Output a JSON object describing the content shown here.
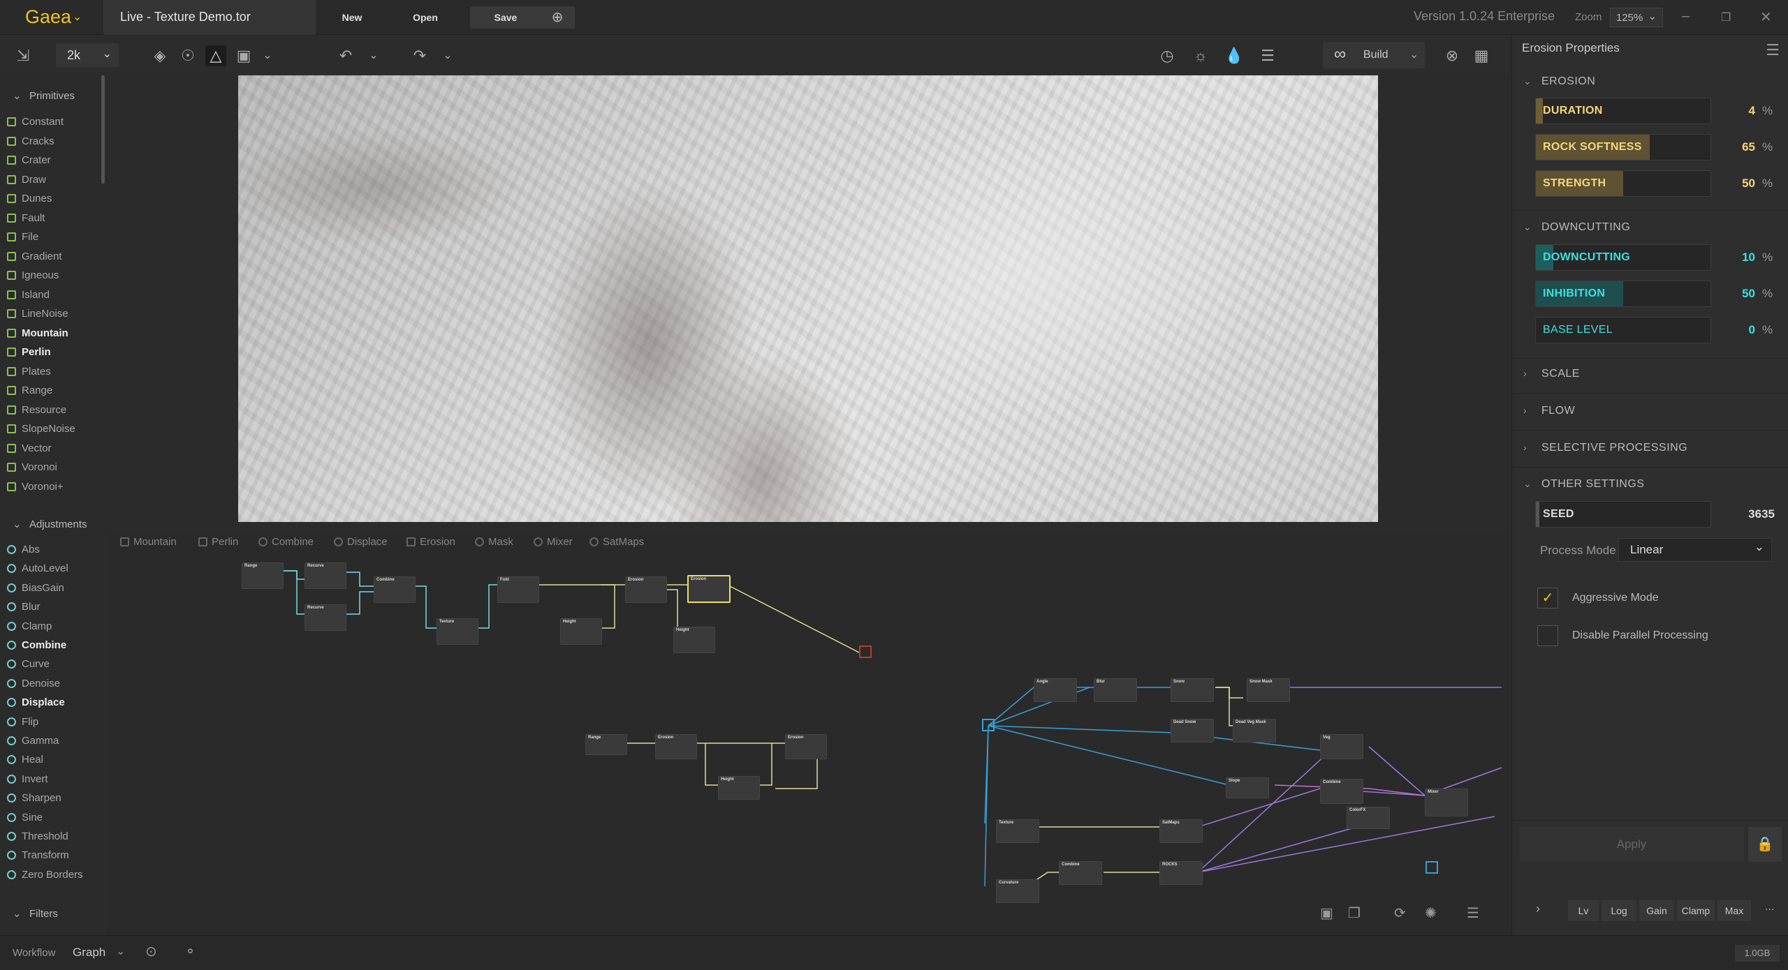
{
  "app": {
    "name": "Gaea",
    "tab_title": "Live - Texture Demo.tor",
    "version": "Version 1.0.24 Enterprise"
  },
  "titlebar": {
    "new_label": "New",
    "open_label": "Open",
    "save_label": "Save",
    "zoom_label": "Zoom",
    "zoom_value": "125%"
  },
  "toolbar": {
    "resolution": "2k",
    "build_label": "Build"
  },
  "left_panel": {
    "primitives_label": "Primitives",
    "primitives": [
      "Constant",
      "Cracks",
      "Crater",
      "Draw",
      "Dunes",
      "Fault",
      "File",
      "Gradient",
      "Igneous",
      "Island",
      "LineNoise",
      "Mountain",
      "Perlin",
      "Plates",
      "Range",
      "Resource",
      "SlopeNoise",
      "Vector",
      "Voronoi",
      "Voronoi+"
    ],
    "adjustments_label": "Adjustments",
    "adjustments": [
      "Abs",
      "AutoLevel",
      "BiasGain",
      "Blur",
      "Clamp",
      "Combine",
      "Curve",
      "Denoise",
      "Displace",
      "Flip",
      "Gamma",
      "Heal",
      "Invert",
      "Sharpen",
      "Sine",
      "Threshold",
      "Transform",
      "Zero Borders"
    ],
    "filters_label": "Filters"
  },
  "graph_tabs": [
    "Mountain",
    "Perlin",
    "Combine",
    "Displace",
    "Erosion",
    "Mask",
    "Mixer",
    "SatMaps"
  ],
  "graph_nodes": {
    "range": "Range",
    "recurve": "Recurve",
    "combine": "Combine",
    "fold": "Fold",
    "erosion": "Erosion",
    "height": "Height",
    "texture": "Texture",
    "angle": "Angle",
    "blur": "Blur",
    "snow": "Snow",
    "snow_mask": "Snow Mask",
    "dead_snow": "Dead Snow",
    "dead_veg_mask": "Dead Veg Mask",
    "veg": "Veg",
    "slope": "Slope",
    "satmaps": "SatMaps",
    "colorfx": "ColorFX",
    "rocks": "ROCKS",
    "curvature": "Curvature",
    "mixer": "Mixer"
  },
  "properties": {
    "title": "Erosion Properties",
    "erosion_section": "EROSION",
    "erosion": [
      {
        "label": "DURATION",
        "value": 4,
        "unit": "%"
      },
      {
        "label": "ROCK SOFTNESS",
        "value": 65,
        "unit": "%"
      },
      {
        "label": "STRENGTH",
        "value": 50,
        "unit": "%"
      }
    ],
    "downcutting_section": "DOWNCUTTING",
    "downcutting": [
      {
        "label": "DOWNCUTTING",
        "value": 10,
        "unit": "%"
      },
      {
        "label": "INHIBITION",
        "value": 50,
        "unit": "%"
      },
      {
        "label": "BASE LEVEL",
        "value": 0,
        "unit": "%"
      }
    ],
    "collapsed_sections": [
      "SCALE",
      "FLOW",
      "SELECTIVE PROCESSING"
    ],
    "other_section": "OTHER SETTINGS",
    "seed_label": "SEED",
    "seed_value": 3635,
    "process_mode_label": "Process Mode",
    "process_mode_value": "Linear",
    "aggressive_mode_label": "Aggressive Mode",
    "aggressive_mode_checked": true,
    "disable_parallel_label": "Disable Parallel Processing",
    "disable_parallel_checked": false,
    "apply_label": "Apply",
    "bottom_tabs": [
      "Lv",
      "Log",
      "Gain",
      "Clamp",
      "Max"
    ],
    "more_label": "..."
  },
  "statusbar": {
    "workflow_label": "Workflow",
    "mode_value": "Graph",
    "memory": "1.0GB"
  },
  "colors": {
    "accent": "#f0c419",
    "erosion_fill": "#7a6a3a",
    "downcutting_fill": "#1e6e6e",
    "erosion_text": "#f5d77a",
    "downcut_text": "#3de0e0"
  }
}
